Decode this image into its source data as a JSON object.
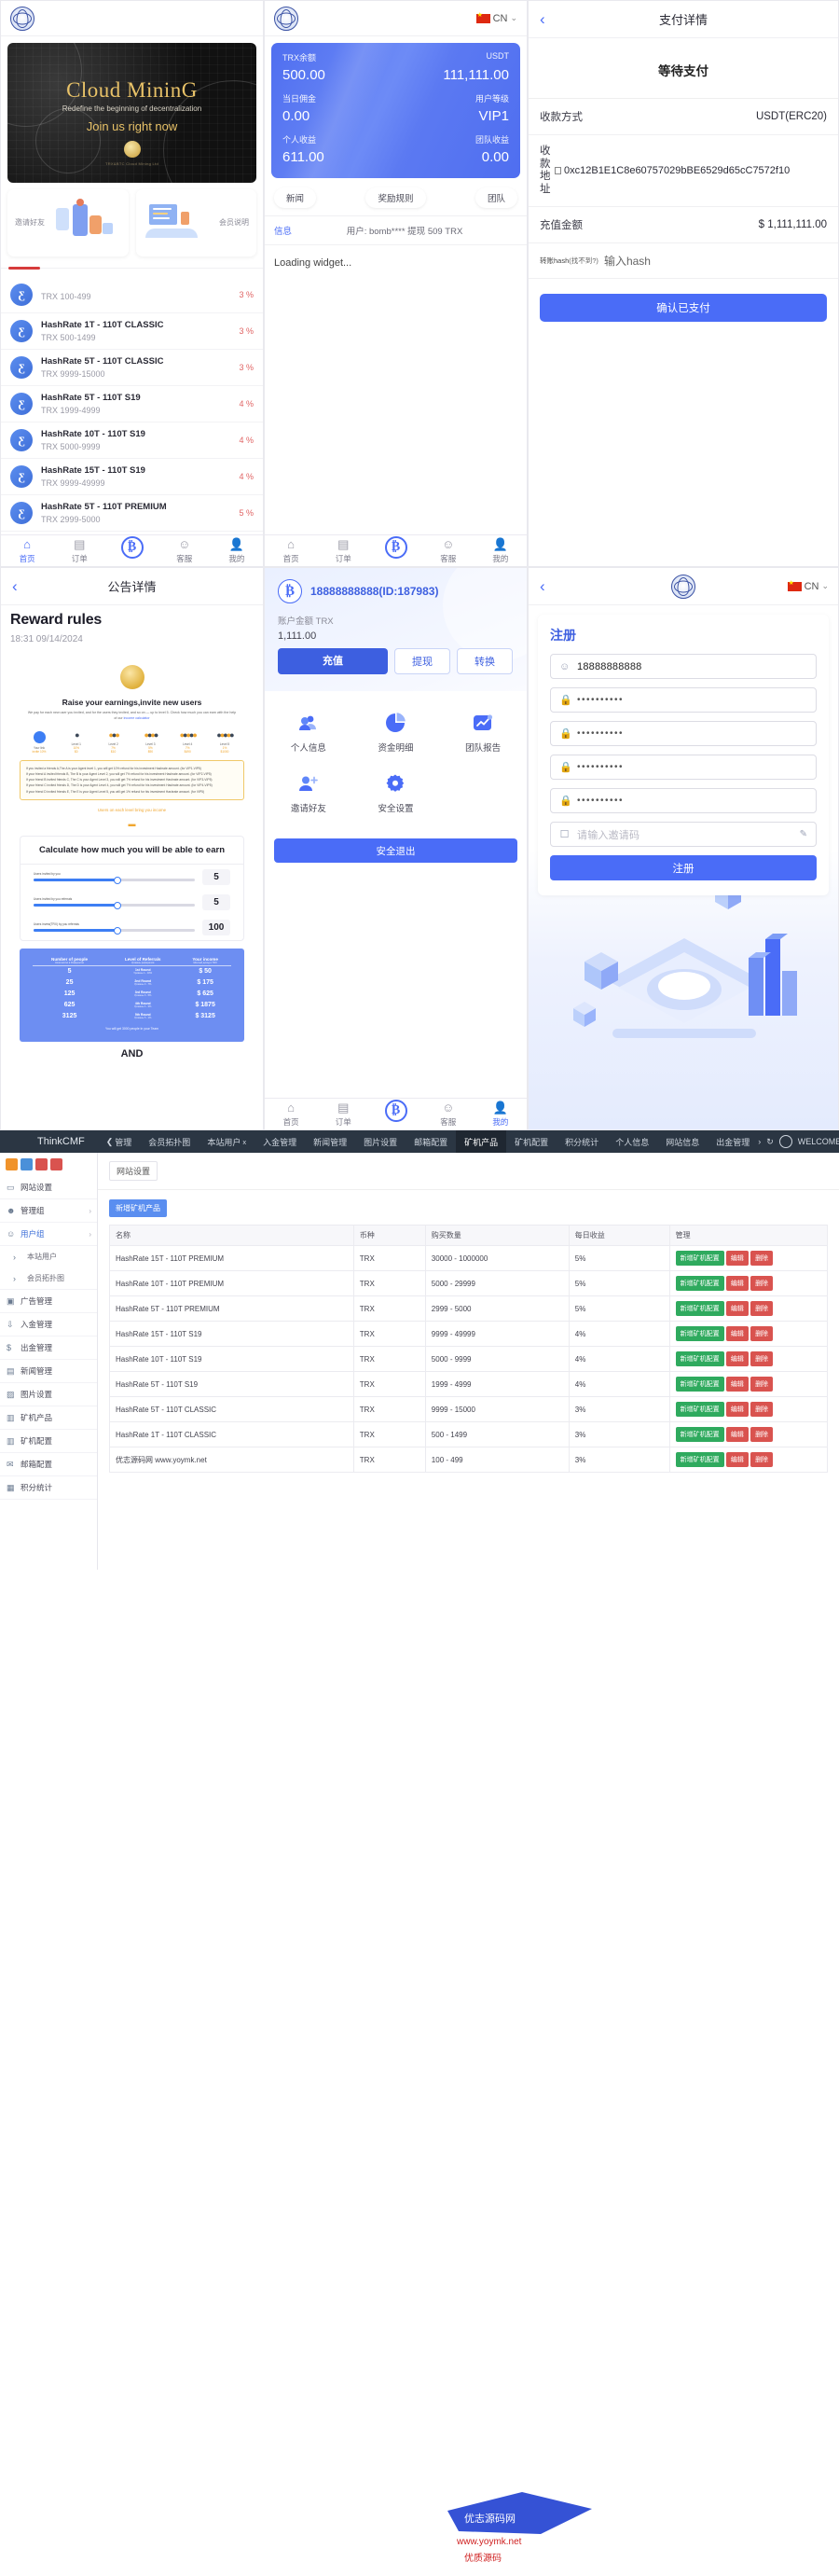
{
  "brand": {
    "logo_icon": "diamond-globe-logo",
    "lang": "CN"
  },
  "panel_home": {
    "banner": {
      "title": "Cloud MininG",
      "subtitle": "Redefine the beginning of decentralization",
      "cta": "Join us right now",
      "footnote": "TRX&BTC Cloud Mining Ltd"
    },
    "cards": [
      {
        "label": "邀请好友",
        "icon": "invite-friends-illustration"
      },
      {
        "label": "会员说明",
        "icon": "member-info-illustration"
      }
    ],
    "products": [
      {
        "title": "",
        "sub": "TRX 100-499",
        "pct": "3 %",
        "icon": "hashrate-icon"
      },
      {
        "title": "HashRate 1T - 110T CLASSIC",
        "sub": "TRX 500-1499",
        "pct": "3 %",
        "icon": "hashrate-icon"
      },
      {
        "title": "HashRate 5T - 110T CLASSIC",
        "sub": "TRX 9999-15000",
        "pct": "3 %",
        "icon": "hashrate-icon"
      },
      {
        "title": "HashRate 5T - 110T S19",
        "sub": "TRX 1999-4999",
        "pct": "4 %",
        "icon": "hashrate-icon"
      },
      {
        "title": "HashRate 10T - 110T S19",
        "sub": "TRX 5000-9999",
        "pct": "4 %",
        "icon": "hashrate-icon"
      },
      {
        "title": "HashRate 15T - 110T S19",
        "sub": "TRX 9999-49999",
        "pct": "4 %",
        "icon": "hashrate-icon"
      },
      {
        "title": "HashRate 5T - 110T PREMIUM",
        "sub": "TRX 2999-5000",
        "pct": "5 %",
        "icon": "hashrate-icon"
      }
    ]
  },
  "tabbar": [
    {
      "label": "首页",
      "icon": "home-icon"
    },
    {
      "label": "订单",
      "icon": "orders-icon"
    },
    {
      "label": "",
      "icon": "bitcoin-icon"
    },
    {
      "label": "客服",
      "icon": "support-chat-icon"
    },
    {
      "label": "我的",
      "icon": "profile-icon"
    }
  ],
  "panel_balance": {
    "card": {
      "k1": "TRX余额",
      "v1": "500.00",
      "k2": "USDT",
      "v2": "111,111.00",
      "k3": "当日佣金",
      "v3": "0.00",
      "k4": "用户等级",
      "v4": "VIP1",
      "k5": "个人收益",
      "v5": "611.00",
      "k6": "团队收益",
      "v6": "0.00"
    },
    "pills": [
      "新闻",
      "奖励规则",
      "团队"
    ],
    "news_label": "信息",
    "news_text": "用户: bomb**** 提现 509 TRX",
    "loading": "Loading widget..."
  },
  "panel_pay": {
    "title": "支付详情",
    "back_icon": "chevron-left-icon",
    "status": "等待支付",
    "rows": [
      {
        "k": "收款方式",
        "v": "USDT(ERC20)"
      },
      {
        "k": "收款地址",
        "v": "0xc12B1E1C8e60757029bBE6529d65cC7572f10"
      },
      {
        "k": "充值金额",
        "v": "$ 1,111,111.00"
      }
    ],
    "hash_label": "转账hash",
    "hash_hint": "(找不到?)",
    "hash_placeholder": "输入hash",
    "confirm_btn": "确认已支付"
  },
  "panel_notice": {
    "title": "公告详情",
    "heading": "Reward rules",
    "date": "18:31 09/14/2024",
    "promo_heading": "Raise your earnings,invite new users",
    "promo_text": "We pay for each new user you invited, and for the users they invited, and so on — up to level 5. Check how much you can earn with the help of our",
    "promo_link": "income calculator",
    "levels": [
      {
        "name": "Your link",
        "note": "invite 10%",
        "n2": "",
        "n3": ""
      },
      {
        "name": "Level 1",
        "note": "10%",
        "n2": "",
        "n3": "$0"
      },
      {
        "name": "Level 2",
        "note": "7%",
        "n2": "",
        "n3": "$10"
      },
      {
        "name": "Level 3",
        "note": "5%",
        "n2": "",
        "n3": "$90"
      },
      {
        "name": "Level 4",
        "note": "7%",
        "n2": "",
        "n3": "$490"
      },
      {
        "name": "Level 5",
        "note": "1%",
        "n2": "",
        "n3": "$1000"
      }
    ],
    "rules": [
      "If you invited a friends A,The A is your Agent level 1, you will get 10% refund for his investment Hashrate amount.  (for VIP1-VIP5)",
      "If your friend A invited  friends B, The B is your Agent Level 2, you will get 7% refund for his investment Hashrate amount.  (for VIP2-VIP5)",
      "If your friend B invited  friends C, The C is your Agent Level 3, you will get 7% refund for his investment Hashrate amount.  (for VIP3-VIP5)",
      "If your friend C invited  friends D, The D is your Agent Level 4, you will get 7% refund for his investment Hashrate amount.  (for VIP4-VIP5)",
      "If your friend D invited  friends E, The E is your Agent Level 5, you will get 1% refund for his investment Hashrate amount.  (for VIP5)"
    ],
    "caption": "Users on each level bring you income",
    "calc_title": "Calculate how much you will be able to earn",
    "calc_rows": [
      {
        "label": "Users invited by you",
        "value": "5"
      },
      {
        "label": "Users invited by you referrals",
        "value": "5"
      },
      {
        "label": "Users invest(TRX) by you referrals",
        "value": "100"
      }
    ],
    "table": {
      "headers": [
        {
          "t": "Number of people",
          "s": "Количество в Рефералов"
        },
        {
          "t": "Level of Referrals",
          "s": "Уровень рефералов"
        },
        {
          "t": "Your income",
          "s": "Монтый доход в TRX"
        }
      ],
      "rows": [
        {
          "people": "5",
          "level": "1st Round",
          "sub": "Уровень 1 - 10%",
          "income": "$ 50"
        },
        {
          "people": "25",
          "level": "2nd Round",
          "sub": "Уровень 2 - 7%",
          "income": "$ 175"
        },
        {
          "people": "125",
          "level": "3rd Round",
          "sub": "Уровень 3 - 5%",
          "income": "$ 625"
        },
        {
          "people": "625",
          "level": "4th Round",
          "sub": "Уровень 4 - 3%",
          "income": "$ 1875"
        },
        {
          "people": "3125",
          "level": "5th Round",
          "sub": "Уровень 5 - 1%",
          "income": "$ 3125"
        }
      ],
      "footer": "You will get 3000 people in your Team"
    },
    "and": "AND"
  },
  "panel_account": {
    "username": "18888888888(ID:187983)",
    "avatar_icon": "bitcoin-icon",
    "balance_label": "账户金额 TRX",
    "balance_value": "1,111.00",
    "buttons": [
      {
        "label": "充值",
        "style": "primary"
      },
      {
        "label": "提现",
        "style": "outline"
      },
      {
        "label": "转换",
        "style": "outline"
      }
    ],
    "grid": [
      {
        "label": "个人信息",
        "icon": "users-icon"
      },
      {
        "label": "资金明细",
        "icon": "pie-chart-icon"
      },
      {
        "label": "团队报告",
        "icon": "trend-chart-icon"
      },
      {
        "label": "邀请好友",
        "icon": "user-plus-icon"
      },
      {
        "label": "安全设置",
        "icon": "gear-icon"
      }
    ],
    "exit_btn": "安全退出"
  },
  "panel_register": {
    "title": "注册",
    "fields": [
      {
        "icon": "user-icon",
        "value": "18888888888",
        "type": "text"
      },
      {
        "icon": "lock-icon",
        "value": "••••••••••",
        "type": "password"
      },
      {
        "icon": "lock-icon",
        "value": "••••••••••",
        "type": "password"
      },
      {
        "icon": "lock-icon",
        "value": "••••••••••",
        "type": "password"
      },
      {
        "icon": "lock-icon",
        "value": "••••••••••",
        "type": "password"
      },
      {
        "icon": "id-card-icon",
        "value": "请输入邀请码",
        "type": "placeholder"
      }
    ],
    "submit": "注册"
  },
  "admin": {
    "brand": "ThinkCMF",
    "nav": [
      {
        "label": "管理",
        "icon": "chevron-left-icon"
      },
      {
        "label": "会员拓扑图"
      },
      {
        "label": "本站用户",
        "close": "x"
      },
      {
        "label": "入金管理"
      },
      {
        "label": "新闻管理"
      },
      {
        "label": "图片设置"
      },
      {
        "label": "邮箱配置"
      },
      {
        "label": "矿机产品",
        "selected": true
      },
      {
        "label": "矿机配置"
      },
      {
        "label": "积分统计"
      },
      {
        "label": "个人信息"
      },
      {
        "label": "网站信息"
      },
      {
        "label": "出金管理"
      }
    ],
    "nav_right": {
      "more": "›",
      "refresh": "↻",
      "user": "WELCOME_USER"
    },
    "sidebar": [
      {
        "label": "网站设置",
        "icon": "monitor-icon"
      },
      {
        "label": "管理组",
        "icon": "users-icon",
        "chevron": "›"
      },
      {
        "label": "用户组",
        "icon": "user-icon",
        "chevron": "›",
        "active": true
      },
      {
        "label": "本站用户",
        "sub": true
      },
      {
        "label": "会员拓扑图",
        "sub": true
      },
      {
        "label": "广告管理",
        "icon": "board-icon"
      },
      {
        "label": "入金管理",
        "icon": "download-icon"
      },
      {
        "label": "出金管理",
        "icon": "dollar-icon"
      },
      {
        "label": "新闻管理",
        "icon": "news-icon"
      },
      {
        "label": "图片设置",
        "icon": "image-icon"
      },
      {
        "label": "矿机产品",
        "icon": "server-icon"
      },
      {
        "label": "矿机配置",
        "icon": "server-icon"
      },
      {
        "label": "邮箱配置",
        "icon": "mail-icon"
      },
      {
        "label": "积分统计",
        "icon": "stats-icon"
      }
    ],
    "breadcrumb": "网站设置",
    "add_button": "新增矿机产品",
    "table": {
      "headers": [
        "名称",
        "币种",
        "购买数量",
        "每日收益",
        "管理"
      ],
      "actions": [
        "新增矿机配置",
        "编辑",
        "删除"
      ],
      "rows": [
        {
          "name": "HashRate 15T - 110T PREMIUM",
          "coin": "TRX",
          "qty": "30000 - 1000000",
          "daily": "5%"
        },
        {
          "name": "HashRate 10T - 110T PREMIUM",
          "coin": "TRX",
          "qty": "5000 - 29999",
          "daily": "5%"
        },
        {
          "name": "HashRate 5T - 110T PREMIUM",
          "coin": "TRX",
          "qty": "2999 - 5000",
          "daily": "5%"
        },
        {
          "name": "HashRate 15T - 110T S19",
          "coin": "TRX",
          "qty": "9999 - 49999",
          "daily": "4%"
        },
        {
          "name": "HashRate 10T - 110T S19",
          "coin": "TRX",
          "qty": "5000 - 9999",
          "daily": "4%"
        },
        {
          "name": "HashRate 5T - 110T S19",
          "coin": "TRX",
          "qty": "1999 - 4999",
          "daily": "4%"
        },
        {
          "name": "HashRate 5T - 110T CLASSIC",
          "coin": "TRX",
          "qty": "9999 - 15000",
          "daily": "3%"
        },
        {
          "name": "HashRate 1T - 110T CLASSIC",
          "coin": "TRX",
          "qty": "500 - 1499",
          "daily": "3%"
        },
        {
          "name": "优志源码网 www.yoymk.net",
          "coin": "TRX",
          "qty": "100 - 499",
          "daily": "3%"
        }
      ]
    }
  },
  "colors": {
    "accent": "#4a6cf7",
    "accent_dark": "#3d5fe0",
    "gold": "#e8c268",
    "danger": "#d9534f",
    "green": "#2faa5e",
    "admin_bar": "#2b3643"
  }
}
